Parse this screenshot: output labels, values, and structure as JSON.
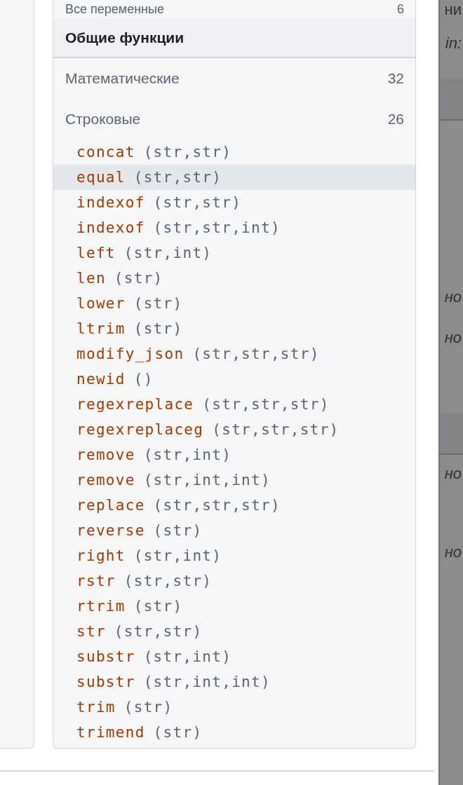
{
  "variables_row": {
    "label": "Все переменные",
    "count": "6"
  },
  "section": {
    "title": "Общие функции"
  },
  "categories": [
    {
      "label": "Математические",
      "count": "32"
    },
    {
      "label": "Строковые",
      "count": "26"
    }
  ],
  "functions": [
    {
      "name": "concat",
      "args": "(str,str)",
      "selected": false
    },
    {
      "name": "equal",
      "args": "(str,str)",
      "selected": true
    },
    {
      "name": "indexof",
      "args": "(str,str)",
      "selected": false
    },
    {
      "name": "indexof",
      "args": "(str,str,int)",
      "selected": false
    },
    {
      "name": "left",
      "args": "(str,int)",
      "selected": false
    },
    {
      "name": "len",
      "args": "(str)",
      "selected": false
    },
    {
      "name": "lower",
      "args": "(str)",
      "selected": false
    },
    {
      "name": "ltrim",
      "args": "(str)",
      "selected": false
    },
    {
      "name": "modify_json",
      "args": "(str,str,str)",
      "selected": false
    },
    {
      "name": "newid",
      "args": "()",
      "selected": false
    },
    {
      "name": "regexreplace",
      "args": "(str,str,str)",
      "selected": false
    },
    {
      "name": "regexreplaceg",
      "args": "(str,str,str)",
      "selected": false
    },
    {
      "name": "remove",
      "args": "(str,int)",
      "selected": false
    },
    {
      "name": "remove",
      "args": "(str,int,int)",
      "selected": false
    },
    {
      "name": "replace",
      "args": "(str,str,str)",
      "selected": false
    },
    {
      "name": "reverse",
      "args": "(str)",
      "selected": false
    },
    {
      "name": "right",
      "args": "(str,int)",
      "selected": false
    },
    {
      "name": "rstr",
      "args": "(str,str)",
      "selected": false
    },
    {
      "name": "rtrim",
      "args": "(str)",
      "selected": false
    },
    {
      "name": "str",
      "args": "(str,str)",
      "selected": false
    },
    {
      "name": "substr",
      "args": "(str,int)",
      "selected": false
    },
    {
      "name": "substr",
      "args": "(str,int,int)",
      "selected": false
    },
    {
      "name": "trim",
      "args": "(str)",
      "selected": false
    },
    {
      "name": "trimend",
      "args": "(str)",
      "selected": false
    }
  ],
  "background_fragments": [
    {
      "kind": "text",
      "text": "ни"
    },
    {
      "kind": "italic",
      "text": "in:"
    },
    {
      "kind": "band"
    },
    {
      "kind": "italic",
      "text": "но"
    },
    {
      "kind": "italic",
      "text": "но"
    },
    {
      "kind": "band"
    },
    {
      "kind": "italic",
      "text": "но"
    },
    {
      "kind": "italic",
      "text": "но"
    }
  ]
}
